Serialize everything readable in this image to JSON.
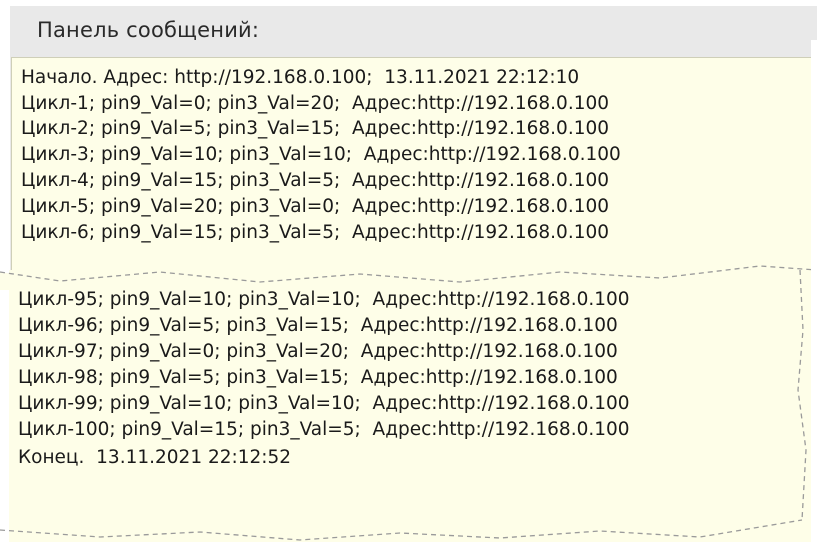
{
  "panel": {
    "title": "Панель сообщений:"
  },
  "log": {
    "top_lines": [
      "Начало. Адрес: http://192.168.0.100;  13.11.2021 22:12:10",
      "Цикл-1; pin9_Val=0; pin3_Val=20;  Адрес:http://192.168.0.100",
      "Цикл-2; pin9_Val=5; pin3_Val=15;  Адрес:http://192.168.0.100",
      "Цикл-3; pin9_Val=10; pin3_Val=10;  Адрес:http://192.168.0.100",
      "Цикл-4; pin9_Val=15; pin3_Val=5;  Адрес:http://192.168.0.100",
      "Цикл-5; pin9_Val=20; pin3_Val=0;  Адрес:http://192.168.0.100",
      "Цикл-6; pin9_Val=15; pin3_Val=5;  Адрес:http://192.168.0.100"
    ],
    "bottom_lines": [
      "Цикл-95; pin9_Val=10; pin3_Val=10;  Адрес:http://192.168.0.100",
      "Цикл-96; pin9_Val=5; pin3_Val=15;  Адрес:http://192.168.0.100",
      "Цикл-97; pin9_Val=0; pin3_Val=20;  Адрес:http://192.168.0.100",
      "Цикл-98; pin9_Val=5; pin3_Val=15;  Адрес:http://192.168.0.100",
      "Цикл-99; pin9_Val=10; pin3_Val=10;  Адрес:http://192.168.0.100",
      "Цикл-100; pin9_Val=15; pin3_Val=5;  Адрес:http://192.168.0.100",
      "Конец.  13.11.2021 22:12:52"
    ]
  },
  "colors": {
    "panel_background": "#e9e9e9",
    "log_background": "#fefee8",
    "text": "#1a1a1a"
  }
}
